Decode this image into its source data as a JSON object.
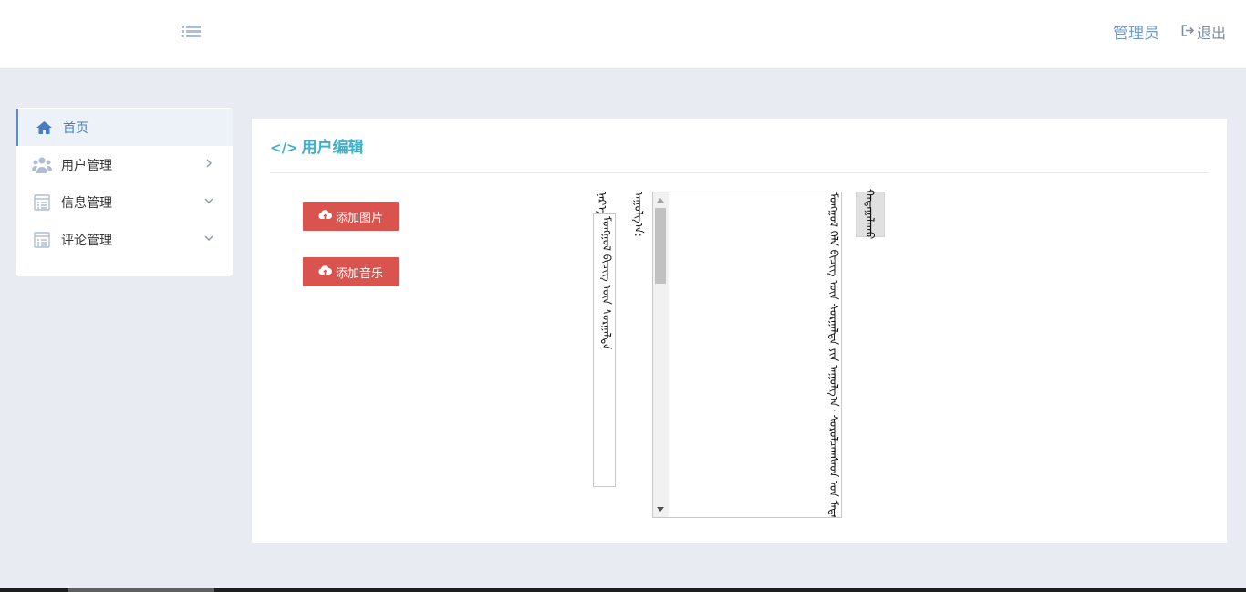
{
  "header": {
    "menu_toggle_icon": "list-icon",
    "admin_label": "管理员",
    "logout_label": "退出",
    "logout_icon": "sign-out-icon"
  },
  "sidebar": {
    "items": [
      {
        "label": "首页",
        "icon": "home-icon",
        "active": true
      },
      {
        "label": "用户管理",
        "icon": "users-icon",
        "arrow": "chevron-right-icon"
      },
      {
        "label": "信息管理",
        "icon": "list-alt-icon",
        "arrow": "chevron-down-icon"
      },
      {
        "label": "评论管理",
        "icon": "list-alt-icon",
        "arrow": "chevron-down-icon"
      }
    ]
  },
  "main": {
    "title_icon": "code-icon",
    "title": "用户编辑",
    "add_image_label": "添加图片",
    "add_music_label": "添加音乐",
    "upload_icon": "cloud-upload-icon",
    "field_label_top": "ᠨᠡᠷ᠎ᠡ:",
    "field_input_value": "ᠮᠣᠩᠭᠣᠯ ᠪᠢᠴᠢᠭ ᠦᠨ ᠰᠤᠷᠭᠠᠯᠲᠠ",
    "content_label": "ᠠᠭᠤᠯᠭ᠎ᠠ:",
    "textarea_value": "ᠮᠣᠩᠭᠣᠯ ᠬᠡᠯᠡ ᠪᠢᠴᠢᠭ ᠦᠨ ᠰᠤᠷᠭᠠᠯᠲᠠ ᠶᠢᠨ ᠠᠭᠤᠯᠭ᠎ᠠ᠂ ᠰᠤᠷᠤᠯᠴᠠᠭᠰᠠᠳ ᠤᠨ ᠮᠡᠳᠡᠯᠭᠡ",
    "submit_label": "ᠬᠠᠳᠠᠭᠠᠯᠠᠬᠤ"
  },
  "colors": {
    "accent": "#3bb0c8",
    "danger": "#d9534f",
    "nav_active": "#5b8fcb",
    "background": "#e8ecf2"
  }
}
